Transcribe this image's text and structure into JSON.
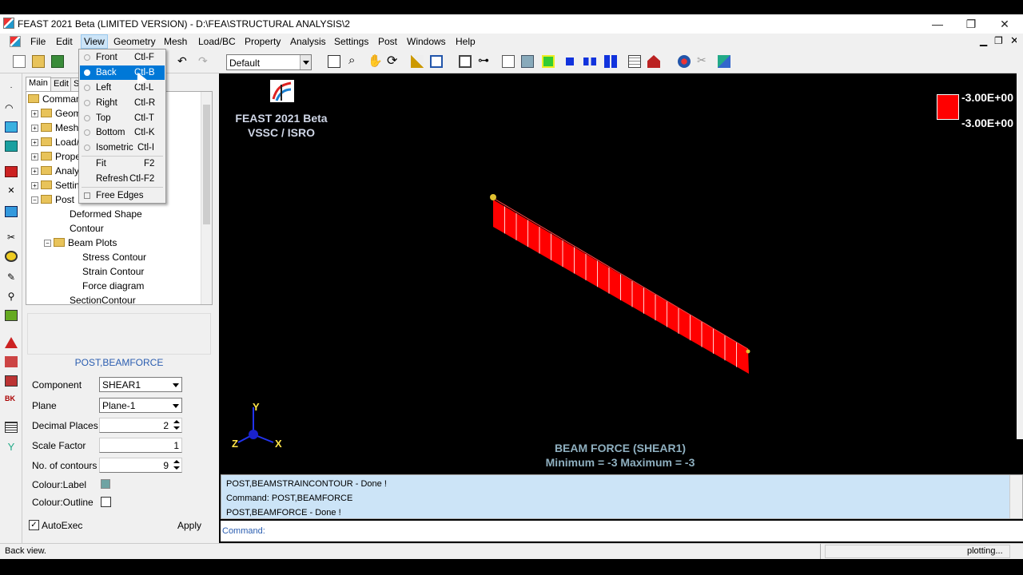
{
  "window": {
    "title": "FEAST 2021 Beta (LIMITED VERSION) - D:\\FEA\\STRUCTURAL ANALYSIS\\2",
    "minimize": "—",
    "maximize": "❐",
    "close": "✕"
  },
  "menu": [
    "File",
    "Edit",
    "View",
    "Geometry",
    "Mesh",
    "Load/BC",
    "Property",
    "Analysis",
    "Settings",
    "Post",
    "Windows",
    "Help"
  ],
  "toolbar": {
    "view_combo": "Default"
  },
  "view_menu": {
    "items": [
      {
        "label": "Front",
        "shortcut": "Ctl-F"
      },
      {
        "label": "Back",
        "shortcut": "Ctl-B"
      },
      {
        "label": "Left",
        "shortcut": "Ctl-L"
      },
      {
        "label": "Right",
        "shortcut": "Ctl-R"
      },
      {
        "label": "Top",
        "shortcut": "Ctl-T"
      },
      {
        "label": "Bottom",
        "shortcut": "Ctl-K"
      },
      {
        "label": "Isometric",
        "shortcut": "Ctl-I"
      },
      {
        "label": "Fit",
        "shortcut": "F2"
      },
      {
        "label": "Refresh",
        "shortcut": "Ctl-F2"
      },
      {
        "label": "Free Edges",
        "shortcut": ""
      }
    ]
  },
  "tabs": [
    "Main",
    "Edit",
    "S"
  ],
  "tree": [
    "Comman",
    "Geom",
    "Mesh",
    "Load/",
    "Prope",
    "Analy",
    "Settin",
    "Post",
    "Deformed Shape",
    "Contour",
    "Beam Plots",
    "Stress Contour",
    "Strain Contour",
    "Force diagram",
    "SectionContour"
  ],
  "form": {
    "header": "POST,BEAMFORCE",
    "component_label": "Component",
    "component_value": "SHEAR1",
    "plane_label": "Plane",
    "plane_value": "Plane-1",
    "decimal_label": "Decimal Places",
    "decimal_value": "2",
    "scale_label": "Scale Factor",
    "scale_value": "1",
    "contours_label": "No. of contours",
    "contours_value": "9",
    "colour_label": "Colour:Label",
    "colour_outline": "Colour:Outline",
    "autoexec": "AutoExec",
    "apply": "Apply"
  },
  "viewport": {
    "brand_line1": "FEAST 2021 Beta",
    "brand_line2": "VSSC / ISRO",
    "legend_max": "-3.00E+00",
    "legend_min": "-3.00E+00",
    "axis_x": "X",
    "axis_y": "Y",
    "axis_z": "Z",
    "plot_title": "BEAM FORCE (SHEAR1)",
    "plot_range": "Minimum = -3  Maximum = -3"
  },
  "output": [
    "POST,BEAMSTRAINCONTOUR - Done !",
    "Command: POST,BEAMFORCE",
    "POST,BEAMFORCE - Done !"
  ],
  "command_label": "Command:",
  "status": {
    "left": "Back view.",
    "right": "plotting..."
  },
  "colors": {
    "beam": "#ff0000",
    "highlight": "#0078d7",
    "output_bg": "#cce4f7"
  }
}
